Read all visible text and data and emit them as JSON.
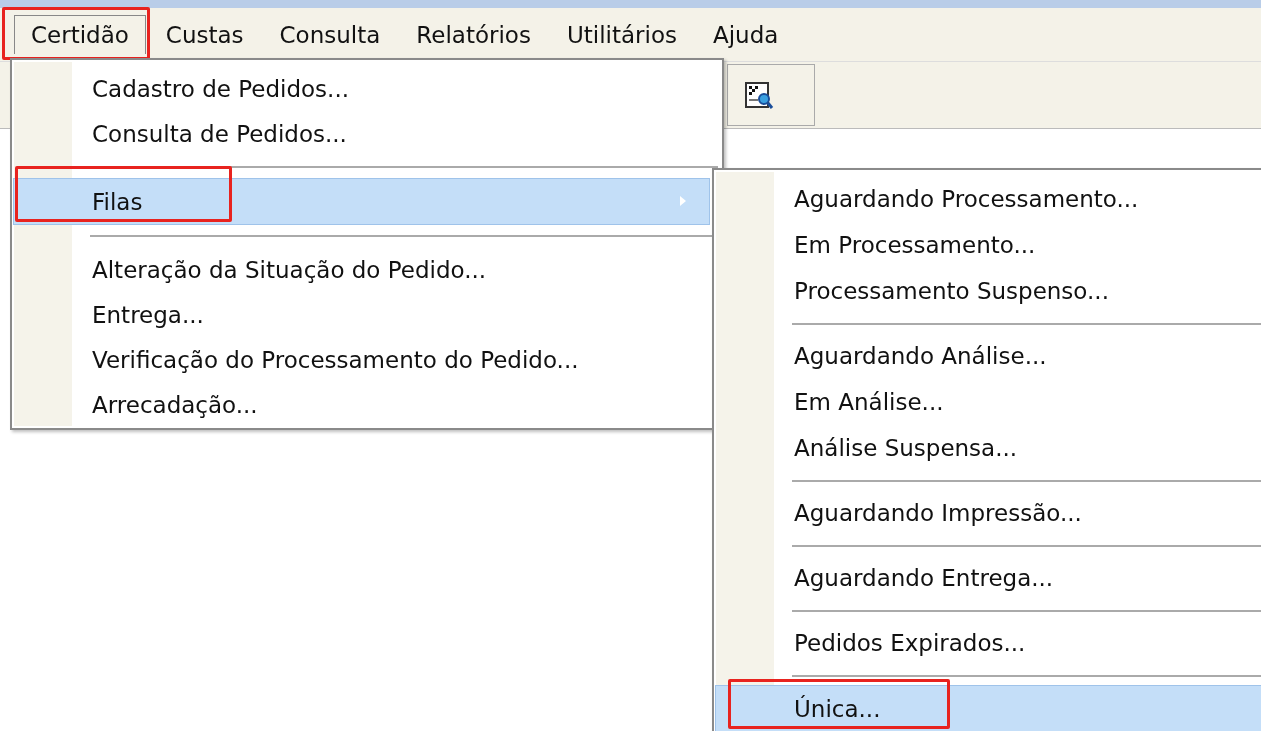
{
  "menubar": [
    {
      "label": "Certidão",
      "selected": true,
      "highlighted": true
    },
    {
      "label": "Custas",
      "selected": false,
      "highlighted": false
    },
    {
      "label": "Consulta",
      "selected": false,
      "highlighted": false
    },
    {
      "label": "Relatórios",
      "selected": false,
      "highlighted": false
    },
    {
      "label": "Utilitários",
      "selected": false,
      "highlighted": false
    },
    {
      "label": "Ajuda",
      "selected": false,
      "highlighted": false
    }
  ],
  "menu": {
    "items": [
      {
        "kind": "item",
        "label": "Cadastro de Pedidos...",
        "selected": false,
        "highlighted": false
      },
      {
        "kind": "item",
        "label": "Consulta de Pedidos...",
        "selected": false,
        "highlighted": false
      },
      {
        "kind": "separator"
      },
      {
        "kind": "submenu",
        "label": "Filas",
        "selected": true,
        "highlighted": true
      },
      {
        "kind": "separator"
      },
      {
        "kind": "item",
        "label": "Alteração da Situação do Pedido...",
        "selected": false,
        "highlighted": false
      },
      {
        "kind": "item",
        "label": "Entrega...",
        "selected": false,
        "highlighted": false
      },
      {
        "kind": "item",
        "label": "Verificação do Processamento do Pedido...",
        "selected": false,
        "highlighted": false
      },
      {
        "kind": "item",
        "label": "Arrecadação...",
        "selected": false,
        "highlighted": false
      }
    ]
  },
  "submenu": {
    "items": [
      {
        "kind": "item",
        "label": "Aguardando Processamento...",
        "selected": false,
        "highlighted": false
      },
      {
        "kind": "item",
        "label": "Em Processamento...",
        "selected": false,
        "highlighted": false
      },
      {
        "kind": "item",
        "label": "Processamento Suspenso...",
        "selected": false,
        "highlighted": false
      },
      {
        "kind": "separator"
      },
      {
        "kind": "item",
        "label": "Aguardando Análise...",
        "selected": false,
        "highlighted": false
      },
      {
        "kind": "item",
        "label": "Em Análise...",
        "selected": false,
        "highlighted": false
      },
      {
        "kind": "item",
        "label": "Análise Suspensa...",
        "selected": false,
        "highlighted": false
      },
      {
        "kind": "separator"
      },
      {
        "kind": "item",
        "label": "Aguardando Impressão...",
        "selected": false,
        "highlighted": false
      },
      {
        "kind": "separator"
      },
      {
        "kind": "item",
        "label": "Aguardando Entrega...",
        "selected": false,
        "highlighted": false
      },
      {
        "kind": "separator"
      },
      {
        "kind": "item",
        "label": "Pedidos Expirados...",
        "selected": false,
        "highlighted": false
      },
      {
        "kind": "separator"
      },
      {
        "kind": "item",
        "label": "Única...",
        "selected": true,
        "highlighted": true
      }
    ]
  }
}
